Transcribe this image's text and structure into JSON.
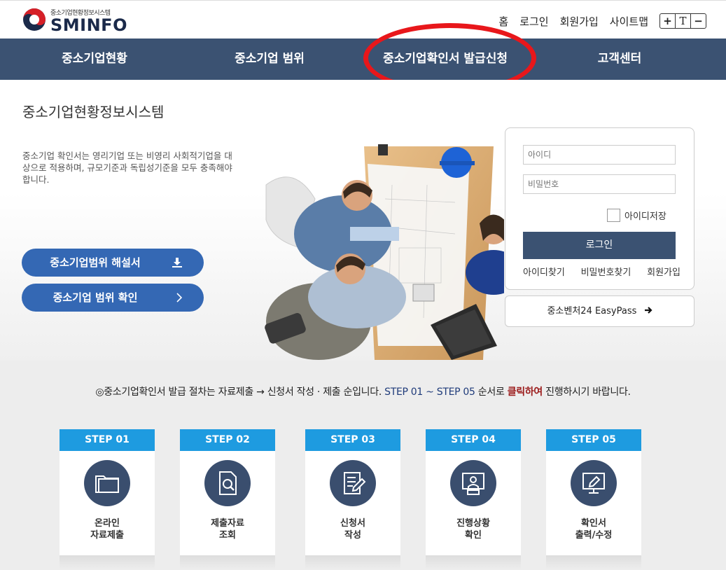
{
  "header": {
    "logo_sub": "중소기업현황정보시스템",
    "logo_main": "SMINFO",
    "util_links": [
      "홈",
      "로그인",
      "회원가입",
      "사이트맵"
    ],
    "font_buttons": [
      "+",
      "T",
      "−"
    ]
  },
  "nav": {
    "items": [
      "중소기업현황",
      "중소기업 범위",
      "중소기업확인서 발급신청",
      "고객센터"
    ]
  },
  "hero": {
    "title": "중소기업현황정보시스템",
    "description": "중소기업 확인서는 영리기업 또는 비영리 사회적기업을 대상으로 적용하며, 규모기준과 독립성기준을 모두 충족해야 합니다.",
    "btn_guide": "중소기업범위 해설서",
    "btn_check": "중소기업 범위 확인"
  },
  "login": {
    "id_placeholder": "아이디",
    "pw_placeholder": "비밀번호",
    "save_id": "아이디저장",
    "login_button": "로그인",
    "find_id": "아이디찾기",
    "find_pw": "비밀번호찾기",
    "join": "회원가입",
    "easypass": "중소벤처24 EasyPass"
  },
  "notice": {
    "part1": "◎중소기업확인서 발급 절차는 자료제출 → 신청서 작성 · 제출 순입니다. ",
    "part2": "STEP 01 ~ STEP 05",
    "part3": " 순서로 ",
    "part4": "클릭하여",
    "part5": " 진행하시기 바랍니다."
  },
  "steps": [
    {
      "num": "STEP 01",
      "line1": "온라인",
      "line2": "자료제출",
      "icon": "folder-icon"
    },
    {
      "num": "STEP 02",
      "line1": "제출자료",
      "line2": "조회",
      "icon": "document-search-icon"
    },
    {
      "num": "STEP 03",
      "line1": "신청서",
      "line2": "작성",
      "icon": "form-edit-icon"
    },
    {
      "num": "STEP 04",
      "line1": "진행상황",
      "line2": "확인",
      "icon": "monitor-user-icon"
    },
    {
      "num": "STEP 05",
      "line1": "확인서",
      "line2": "출력/수정",
      "icon": "monitor-edit-icon"
    }
  ],
  "colors": {
    "nav_bg": "#3b5272",
    "step_header": "#1e9be0",
    "pill": "#3468b4",
    "highlight": "#e8171b"
  }
}
